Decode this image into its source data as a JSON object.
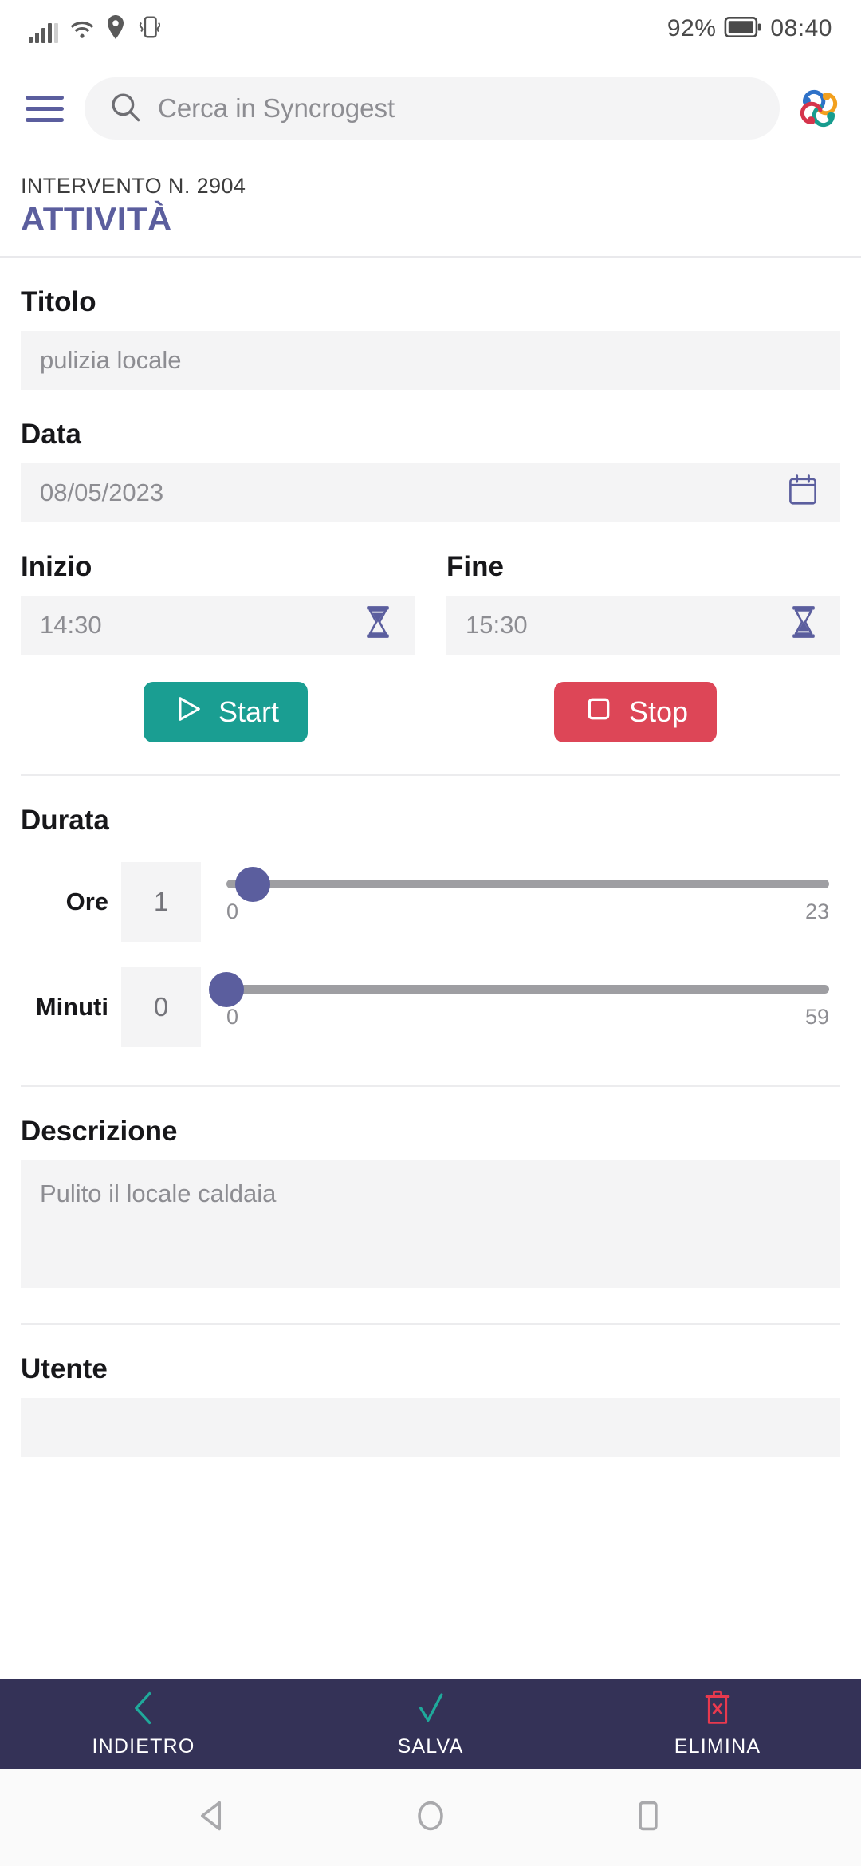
{
  "status_bar": {
    "signal_icon": "cellular-signal-icon",
    "wifi_icon": "wifi-icon",
    "location_icon": "location-pin-icon",
    "vibrate_icon": "vibrate-icon",
    "battery_percent": "92%",
    "battery_icon": "battery-icon",
    "time": "08:40"
  },
  "app_bar": {
    "menu_icon": "hamburger-menu-icon",
    "search_icon": "search-icon",
    "search_placeholder": "Cerca in Syncrogest",
    "search_value": "",
    "logo_icon": "syncrogest-logo-icon"
  },
  "page_header": {
    "kicker": "INTERVENTO N. 2904",
    "title": "ATTIVITÀ"
  },
  "form": {
    "titolo": {
      "label": "Titolo",
      "value": "pulizia locale",
      "placeholder": "pulizia locale"
    },
    "data": {
      "label": "Data",
      "value": "08/05/2023",
      "icon": "calendar-icon"
    },
    "inizio": {
      "label": "Inizio",
      "value": "14:30",
      "icon": "hourglass-start-icon"
    },
    "fine": {
      "label": "Fine",
      "value": "15:30",
      "icon": "hourglass-end-icon"
    },
    "start_button": {
      "label": "Start",
      "icon": "play-icon",
      "color": "#1a9e92"
    },
    "stop_button": {
      "label": "Stop",
      "icon": "stop-square-icon",
      "color": "#dd4657"
    },
    "durata": {
      "label": "Durata",
      "ore": {
        "label": "Ore",
        "value": "1",
        "min_label": "0",
        "max_label": "23",
        "min": 0,
        "max": 23,
        "current": 1
      },
      "minuti": {
        "label": "Minuti",
        "value": "0",
        "min_label": "0",
        "max_label": "59",
        "min": 0,
        "max": 59,
        "current": 0
      }
    },
    "descrizione": {
      "label": "Descrizione",
      "value": "Pulito il locale caldaia",
      "placeholder": "Pulito il locale caldaia"
    },
    "utente": {
      "label": "Utente",
      "value": ""
    }
  },
  "bottom_bar": {
    "background": "#343257",
    "items": [
      {
        "label": "INDIETRO",
        "icon": "chevron-left-icon",
        "color": "#1fa99b"
      },
      {
        "label": "SALVA",
        "icon": "check-icon",
        "color": "#1fa99b"
      },
      {
        "label": "ELIMINA",
        "icon": "trash-delete-icon",
        "color": "#e8394e"
      }
    ]
  },
  "android_nav": {
    "back_icon": "nav-back-triangle-icon",
    "home_icon": "nav-home-circle-icon",
    "recents_icon": "nav-recents-square-icon"
  },
  "colors": {
    "accent_purple": "#5b5e9e",
    "teal": "#1a9e92",
    "red": "#dd4657",
    "navy": "#343257",
    "field_bg": "#f4f4f5"
  }
}
